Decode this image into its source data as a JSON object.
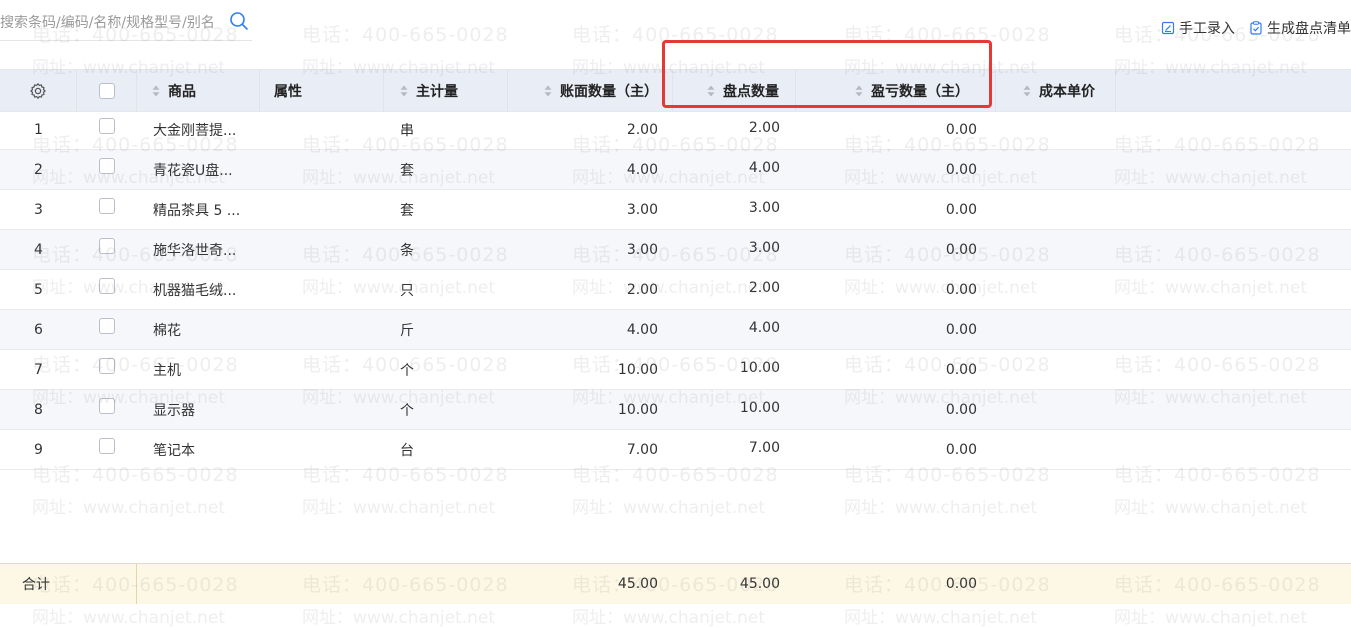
{
  "search": {
    "placeholder": "搜索条码/编码/名称/规格型号/别名",
    "icon": "search-icon"
  },
  "toolbar": {
    "manual_entry_label": "手工录入",
    "generate_list_label": "生成盘点清单",
    "icon_color": "#2f7cf6"
  },
  "watermark": {
    "phone": "电话：400-665-0028",
    "site": "网址：www.chanjet.net"
  },
  "table": {
    "settings_icon": "gear-icon",
    "columns": {
      "product": "商品",
      "attribute": "属性",
      "unit": "主计量",
      "book_qty": "账面数量（主）",
      "count_qty": "盘点数量",
      "diff_qty": "盈亏数量（主）",
      "unit_cost": "成本单价"
    },
    "rows": [
      {
        "idx": "1",
        "product": "大金刚菩提...",
        "unit": "串",
        "book_qty": "2.00",
        "count_qty": "2.00",
        "diff_qty": "0.00"
      },
      {
        "idx": "2",
        "product": "青花瓷U盘...",
        "unit": "套",
        "book_qty": "4.00",
        "count_qty": "4.00",
        "diff_qty": "0.00"
      },
      {
        "idx": "3",
        "product": "精品茶具 5 ...",
        "unit": "套",
        "book_qty": "3.00",
        "count_qty": "3.00",
        "diff_qty": "0.00"
      },
      {
        "idx": "4",
        "product": "施华洛世奇...",
        "unit": "条",
        "book_qty": "3.00",
        "count_qty": "3.00",
        "diff_qty": "0.00"
      },
      {
        "idx": "5",
        "product": "机器猫毛绒...",
        "unit": "只",
        "book_qty": "2.00",
        "count_qty": "2.00",
        "diff_qty": "0.00"
      },
      {
        "idx": "6",
        "product": "棉花",
        "unit": "斤",
        "book_qty": "4.00",
        "count_qty": "4.00",
        "diff_qty": "0.00"
      },
      {
        "idx": "7",
        "product": "主机",
        "unit": "个",
        "book_qty": "10.00",
        "count_qty": "10.00",
        "diff_qty": "0.00"
      },
      {
        "idx": "8",
        "product": "显示器",
        "unit": "个",
        "book_qty": "10.00",
        "count_qty": "10.00",
        "diff_qty": "0.00"
      },
      {
        "idx": "9",
        "product": "笔记本",
        "unit": "台",
        "book_qty": "7.00",
        "count_qty": "7.00",
        "diff_qty": "0.00"
      }
    ],
    "footer": {
      "label": "合计",
      "book_qty": "45.00",
      "count_qty": "45.00",
      "diff_qty": "0.00"
    }
  },
  "colors": {
    "header_bg": "#e9edf6",
    "highlight": "#e53935",
    "footer_bg": "#fdf8e5"
  }
}
